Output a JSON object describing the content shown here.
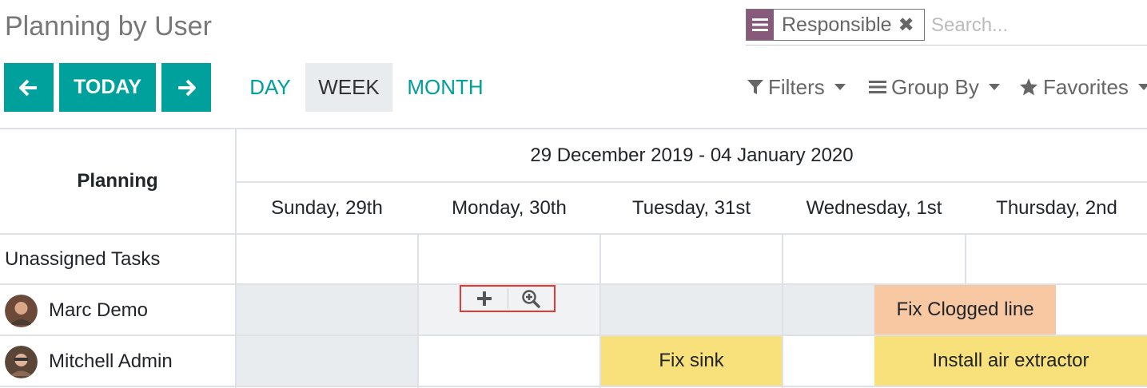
{
  "page": {
    "title": "Planning by User"
  },
  "search": {
    "facet_label": "Responsible",
    "facet_remove_glyph": "✖",
    "placeholder": "Search...",
    "facet_icon": "list-icon"
  },
  "nav": {
    "prev_glyph": "🡐",
    "today_label": "TODAY",
    "next_glyph": "🡒",
    "scales": [
      "DAY",
      "WEEK",
      "MONTH"
    ],
    "active_scale": "WEEK"
  },
  "controls": {
    "filters": "Filters",
    "group_by": "Group By",
    "favorites": "Favorites"
  },
  "grid": {
    "header": "Planning",
    "range": "29 December 2019 - 04 January 2020",
    "days": [
      "Sunday, 29th",
      "Monday, 30th",
      "Tuesday, 31st",
      "Wednesday, 1st",
      "Thursday, 2nd"
    ],
    "rows": [
      "Unassigned Tasks",
      "Marc Demo",
      "Mitchell Admin"
    ],
    "tasks": [
      {
        "row": "Marc Demo",
        "name": "Fix Clogged line"
      },
      {
        "row": "Mitchell Admin",
        "name": "Fix sink"
      },
      {
        "row": "Mitchell Admin",
        "name": "Install air extractor"
      }
    ]
  },
  "colors": {
    "brand": "#00a09d",
    "facet": "#875a7b",
    "task_orange": "#f8c8a2",
    "task_yellow": "#f8e07a",
    "highlight_border": "#e53935"
  }
}
